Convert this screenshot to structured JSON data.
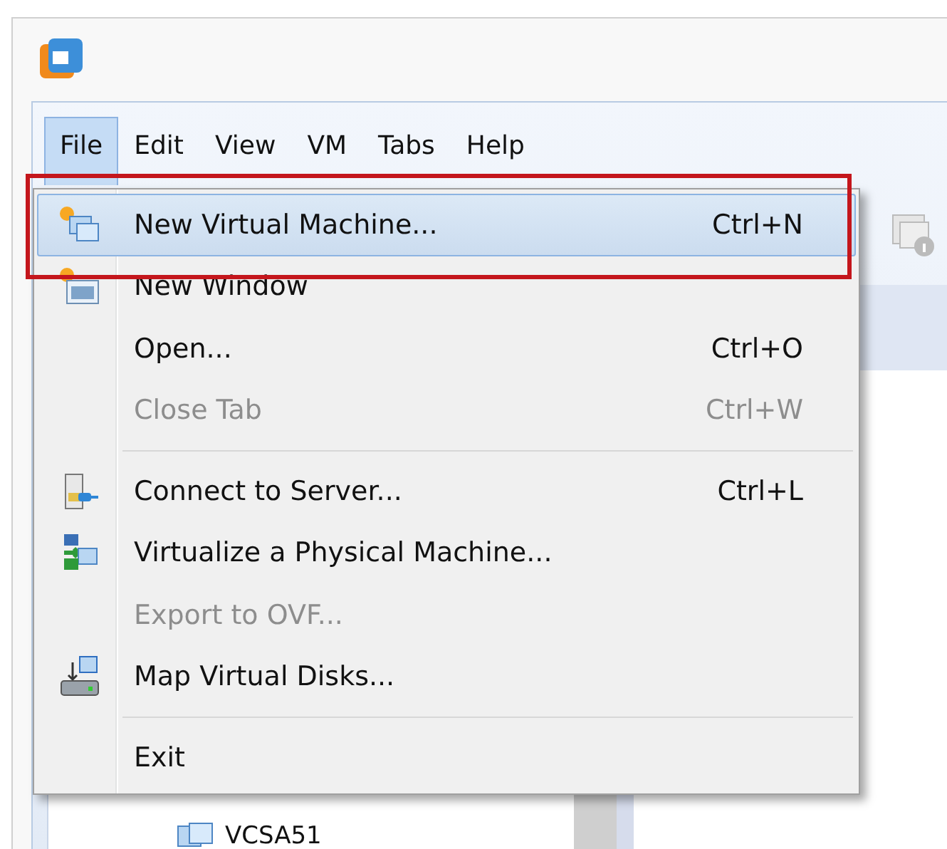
{
  "menu_bar": [
    {
      "label": "File",
      "selected": true
    },
    {
      "label": "Edit",
      "selected": false
    },
    {
      "label": "View",
      "selected": false
    },
    {
      "label": "VM",
      "selected": false
    },
    {
      "label": "Tabs",
      "selected": false
    },
    {
      "label": "Help",
      "selected": false
    }
  ],
  "file_menu": [
    {
      "kind": "item",
      "label": "New Virtual Machine...",
      "shortcut": "Ctrl+N",
      "selected": true,
      "disabled": false
    },
    {
      "kind": "item",
      "label": "New Window",
      "selected": false,
      "disabled": false
    },
    {
      "kind": "item",
      "label": "Open...",
      "shortcut": "Ctrl+O",
      "selected": false,
      "disabled": false
    },
    {
      "kind": "item",
      "label": "Close Tab",
      "shortcut": "Ctrl+W",
      "selected": false,
      "disabled": true
    },
    {
      "kind": "separator"
    },
    {
      "kind": "item",
      "label": "Connect to Server...",
      "shortcut": "Ctrl+L",
      "selected": false,
      "disabled": false
    },
    {
      "kind": "item",
      "label": "Virtualize a Physical Machine...",
      "selected": false,
      "disabled": false
    },
    {
      "kind": "item",
      "label": "Export to OVF...",
      "selected": false,
      "disabled": true
    },
    {
      "kind": "item",
      "label": "Map Virtual Disks...",
      "selected": false,
      "disabled": false
    },
    {
      "kind": "separator"
    },
    {
      "kind": "item",
      "label": "Exit",
      "selected": false,
      "disabled": false
    }
  ],
  "library": {
    "items": [
      {
        "label": "VCSA51"
      }
    ]
  }
}
